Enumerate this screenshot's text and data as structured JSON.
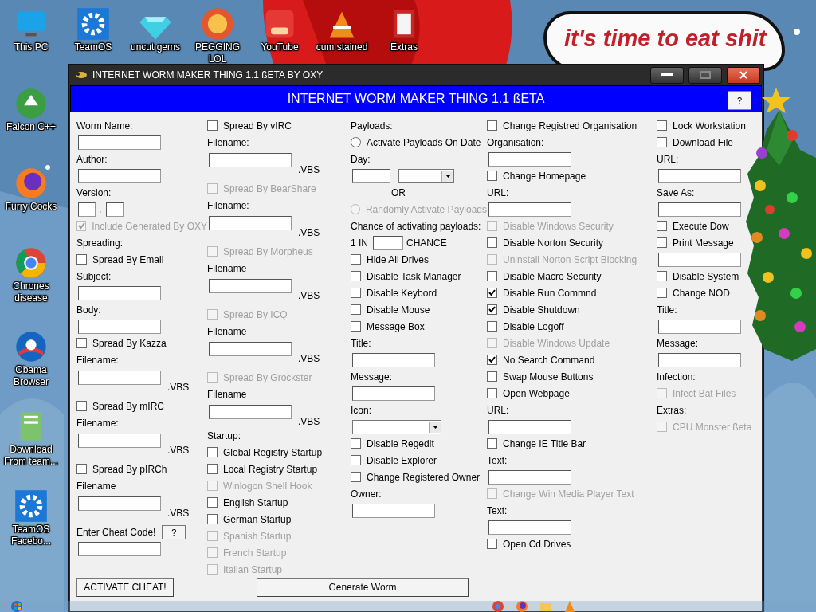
{
  "desktop_icons": [
    {
      "label": "This PC"
    },
    {
      "label": "TeamOS"
    },
    {
      "label": "uncut gems"
    },
    {
      "label": "PEGGING LOL"
    },
    {
      "label": "YouTube"
    },
    {
      "label": "cum stained"
    },
    {
      "label": "Extras"
    },
    {
      "label": "Falcon C++"
    },
    {
      "label": "Furry Cocks"
    },
    {
      "label": "Chrones disease"
    },
    {
      "label": "Obama Browser"
    },
    {
      "label": "Download From team..."
    },
    {
      "label": "TeamOS Facebo..."
    }
  ],
  "speech_bubble": {
    "text": "it's time to eat shit"
  },
  "window": {
    "title": "INTERNET WORM MAKER THING 1.1 ßETA BY OXY",
    "header": "INTERNET WORM MAKER THING 1.1 ßETA",
    "help_button": "?"
  },
  "columns": [
    [
      {
        "kind": "label",
        "text": "Worm Name:"
      },
      {
        "kind": "field"
      },
      {
        "kind": "label",
        "text": "Author:"
      },
      {
        "kind": "field"
      },
      {
        "kind": "label",
        "text": "Version:"
      },
      {
        "kind": "version",
        "separator": "."
      },
      {
        "kind": "check",
        "text": "Include Generated By OXY",
        "checked": true,
        "disabled": true
      },
      {
        "kind": "label",
        "text": "Spreading:"
      },
      {
        "kind": "check",
        "text": "Spread By Email",
        "checked": false,
        "disabled": false
      },
      {
        "kind": "label",
        "text": "Subject:"
      },
      {
        "kind": "field"
      },
      {
        "kind": "label",
        "text": "Body:"
      },
      {
        "kind": "field"
      },
      {
        "kind": "check",
        "text": "Spread By Kazza",
        "checked": false,
        "disabled": false
      },
      {
        "kind": "label",
        "text": "Filename:"
      },
      {
        "kind": "field",
        "suffix": ".VBS"
      },
      {
        "kind": "check",
        "text": "Spread By mIRC",
        "checked": false,
        "disabled": false
      },
      {
        "kind": "label",
        "text": "Filename:"
      },
      {
        "kind": "field",
        "suffix": ".VBS"
      },
      {
        "kind": "check",
        "text": "Spread By pIRCh",
        "checked": false,
        "disabled": false
      },
      {
        "kind": "label",
        "text": "Filename"
      },
      {
        "kind": "field",
        "suffix": ".VBS"
      },
      {
        "kind": "cheat",
        "text": "Enter Cheat Code!",
        "button": "?"
      },
      {
        "kind": "field"
      }
    ],
    [
      {
        "kind": "check",
        "text": "Spread By vIRC",
        "checked": false,
        "disabled": false
      },
      {
        "kind": "label",
        "text": "Filename:"
      },
      {
        "kind": "field",
        "suffix": ".VBS"
      },
      {
        "kind": "check",
        "text": "Spread By BearShare",
        "checked": false,
        "disabled": true
      },
      {
        "kind": "label",
        "text": "Filename:"
      },
      {
        "kind": "field",
        "suffix": ".VBS"
      },
      {
        "kind": "check",
        "text": "Spread By Morpheus",
        "checked": false,
        "disabled": true
      },
      {
        "kind": "label",
        "text": "Filename"
      },
      {
        "kind": "field",
        "suffix": ".VBS"
      },
      {
        "kind": "check",
        "text": "Spread By ICQ",
        "checked": false,
        "disabled": true
      },
      {
        "kind": "label",
        "text": "Filename"
      },
      {
        "kind": "field",
        "suffix": ".VBS"
      },
      {
        "kind": "check",
        "text": "Spread By Grockster",
        "checked": false,
        "disabled": true
      },
      {
        "kind": "label",
        "text": "Filename"
      },
      {
        "kind": "field",
        "suffix": ".VBS"
      },
      {
        "kind": "label",
        "text": "Startup:"
      },
      {
        "kind": "check",
        "text": "Global Registry Startup",
        "checked": false,
        "disabled": false
      },
      {
        "kind": "check",
        "text": "Local Registry Startup",
        "checked": false,
        "disabled": false
      },
      {
        "kind": "check",
        "text": "Winlogon Shell Hook",
        "checked": false,
        "disabled": true
      },
      {
        "kind": "check",
        "text": "English Startup",
        "checked": false,
        "disabled": false
      },
      {
        "kind": "check",
        "text": "German Startup",
        "checked": false,
        "disabled": false
      },
      {
        "kind": "check",
        "text": "Spanish Startup",
        "checked": false,
        "disabled": true
      },
      {
        "kind": "check",
        "text": "French Startup",
        "checked": false,
        "disabled": true
      },
      {
        "kind": "check",
        "text": "Italian Startup",
        "checked": false,
        "disabled": true
      }
    ],
    [
      {
        "kind": "label",
        "text": "Payloads:"
      },
      {
        "kind": "radio",
        "text": "Activate Payloads On Date",
        "selected": false,
        "disabled": false
      },
      {
        "kind": "label",
        "text": "Day:"
      },
      {
        "kind": "day"
      },
      {
        "kind": "center",
        "text": "OR"
      },
      {
        "kind": "radio",
        "text": "Randomly Activate Payloads",
        "selected": false,
        "disabled": true
      },
      {
        "kind": "label",
        "text": "Chance of activating payloads:"
      },
      {
        "kind": "chance",
        "before": "1 IN",
        "after": "CHANCE"
      },
      {
        "kind": "check",
        "text": "Hide All Drives",
        "checked": false,
        "disabled": false
      },
      {
        "kind": "check",
        "text": "Disable Task Manager",
        "checked": false,
        "disabled": false
      },
      {
        "kind": "check",
        "text": "Disable Keybord",
        "checked": false,
        "disabled": false
      },
      {
        "kind": "check",
        "text": "Disable Mouse",
        "checked": false,
        "disabled": false
      },
      {
        "kind": "check",
        "text": "Message Box",
        "checked": false,
        "disabled": false
      },
      {
        "kind": "label",
        "text": "Title:"
      },
      {
        "kind": "field"
      },
      {
        "kind": "label",
        "text": "Message:"
      },
      {
        "kind": "field"
      },
      {
        "kind": "label",
        "text": "Icon:"
      },
      {
        "kind": "select"
      },
      {
        "kind": "check",
        "text": "Disable Regedit",
        "checked": false,
        "disabled": false
      },
      {
        "kind": "check",
        "text": "Disable Explorer",
        "checked": false,
        "disabled": false
      },
      {
        "kind": "check",
        "text": "Change Registered Owner",
        "checked": false,
        "disabled": false
      },
      {
        "kind": "label",
        "text": "Owner:"
      },
      {
        "kind": "field"
      }
    ],
    [
      {
        "kind": "check",
        "text": "Change Registred Organisation",
        "checked": false,
        "disabled": false
      },
      {
        "kind": "label",
        "text": "Organisation:"
      },
      {
        "kind": "field"
      },
      {
        "kind": "check",
        "text": "Change Homepage",
        "checked": false,
        "disabled": false
      },
      {
        "kind": "label",
        "text": "URL:"
      },
      {
        "kind": "field"
      },
      {
        "kind": "check",
        "text": "Disable Windows Security",
        "checked": false,
        "disabled": true
      },
      {
        "kind": "check",
        "text": "Disable Norton Security",
        "checked": false,
        "disabled": false
      },
      {
        "kind": "check",
        "text": "Uninstall Norton Script Blocking",
        "checked": false,
        "disabled": true
      },
      {
        "kind": "check",
        "text": "Disable Macro Security",
        "checked": false,
        "disabled": false
      },
      {
        "kind": "check",
        "text": "Disable Run Commnd",
        "checked": true,
        "disabled": false
      },
      {
        "kind": "check",
        "text": "Disable Shutdown",
        "checked": true,
        "disabled": false
      },
      {
        "kind": "check",
        "text": "Disable Logoff",
        "checked": false,
        "disabled": false
      },
      {
        "kind": "check",
        "text": "Disable Windows Update",
        "checked": false,
        "disabled": true
      },
      {
        "kind": "check",
        "text": "No Search Command",
        "checked": true,
        "disabled": false
      },
      {
        "kind": "check",
        "text": "Swap Mouse Buttons",
        "checked": false,
        "disabled": false
      },
      {
        "kind": "check",
        "text": "Open Webpage",
        "checked": false,
        "disabled": false
      },
      {
        "kind": "label",
        "text": "URL:"
      },
      {
        "kind": "field"
      },
      {
        "kind": "check",
        "text": "Change IE Title Bar",
        "checked": false,
        "disabled": false
      },
      {
        "kind": "label",
        "text": "Text:"
      },
      {
        "kind": "field"
      },
      {
        "kind": "check",
        "text": "Change Win Media Player Text",
        "checked": false,
        "disabled": true
      },
      {
        "kind": "label",
        "text": "Text:"
      },
      {
        "kind": "field"
      },
      {
        "kind": "check",
        "text": "Open Cd Drives",
        "checked": false,
        "disabled": false
      }
    ],
    [
      {
        "kind": "check",
        "text": "Lock Workstation",
        "checked": false,
        "disabled": false
      },
      {
        "kind": "check",
        "text": "Download File",
        "checked": false,
        "disabled": false
      },
      {
        "kind": "label",
        "text": "URL:"
      },
      {
        "kind": "field"
      },
      {
        "kind": "label",
        "text": "Save As:"
      },
      {
        "kind": "field"
      },
      {
        "kind": "check",
        "text": "Execute Dow",
        "checked": false,
        "disabled": false
      },
      {
        "kind": "check",
        "text": "Print Message",
        "checked": false,
        "disabled": false
      },
      {
        "kind": "field"
      },
      {
        "kind": "check",
        "text": "Disable System",
        "checked": false,
        "disabled": false
      },
      {
        "kind": "check",
        "text": "Change NOD",
        "checked": false,
        "disabled": false
      },
      {
        "kind": "label",
        "text": "Title:"
      },
      {
        "kind": "field"
      },
      {
        "kind": "label",
        "text": "Message:"
      },
      {
        "kind": "field"
      },
      {
        "kind": "label",
        "text": "Infection:"
      },
      {
        "kind": "check",
        "text": "Infect Bat Files",
        "checked": false,
        "disabled": true
      },
      {
        "kind": "label",
        "text": "Extras:"
      },
      {
        "kind": "check",
        "text": "CPU Monster ßeta",
        "checked": false,
        "disabled": true
      }
    ]
  ],
  "buttons": [
    {
      "label": "ACTIVATE CHEAT!"
    },
    {
      "label": "Generate Worm"
    }
  ]
}
